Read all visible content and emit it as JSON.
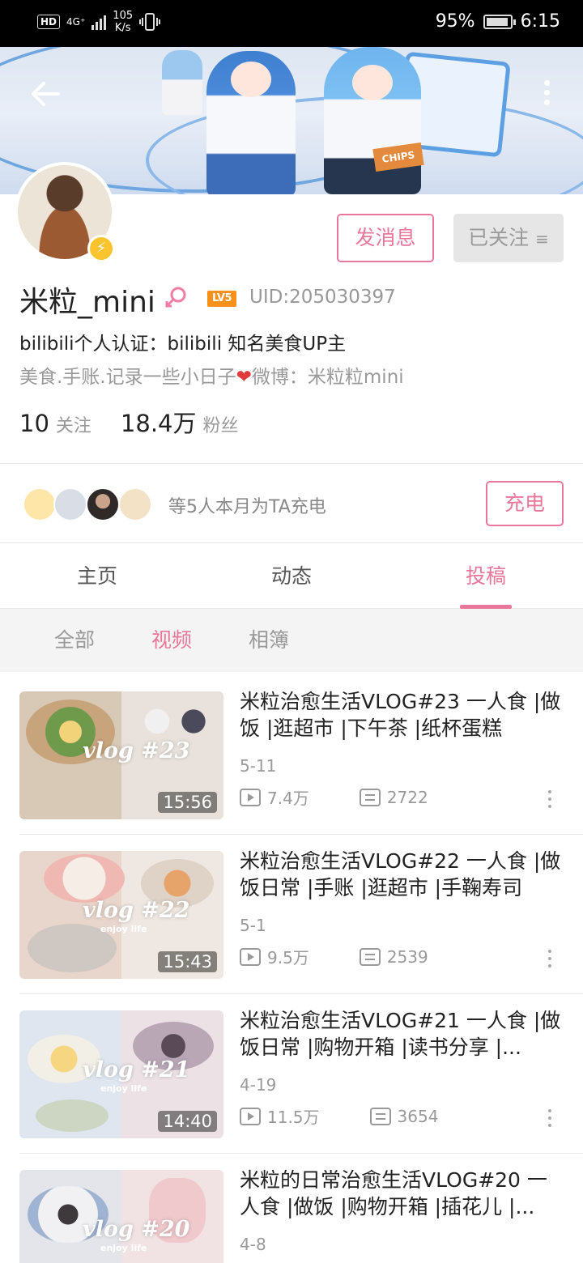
{
  "status_bar": {
    "hd": "HD",
    "network": "4G⁺",
    "speed_value": "105",
    "speed_unit": "K/s",
    "battery": "95%",
    "time": "6:15"
  },
  "banner": {
    "chips_text": "CHIPS"
  },
  "profile": {
    "name": "米粒_mini",
    "level": "LV5",
    "uid": "UID:205030397",
    "official": "bilibili个人认证：bilibili 知名美食UP主",
    "sign_part1": "美食.手账.记录一些小日子",
    "sign_heart": "❤",
    "sign_part2": "微博：米粒粒mini",
    "following_count": "10",
    "following_label": "关注",
    "fans_count": "18.4万",
    "fans_label": "粉丝"
  },
  "actions": {
    "message": "发消息",
    "followed": "已关注",
    "followed_icon": "≡"
  },
  "charge": {
    "text": "等5人本月为TA充电",
    "button": "充电"
  },
  "tabs": [
    {
      "label": "主页",
      "active": false
    },
    {
      "label": "动态",
      "active": false
    },
    {
      "label": "投稿",
      "active": true
    }
  ],
  "subtabs": [
    {
      "label": "全部",
      "active": false
    },
    {
      "label": "视频",
      "active": true
    },
    {
      "label": "相簿",
      "active": false
    }
  ],
  "videos": [
    {
      "title": "米粒治愈生活VLOG#23  一人食 |做饭 |逛超市 |下午茶 |纸杯蛋糕",
      "date": "5-11",
      "views": "7.4万",
      "danmaku": "2722",
      "duration": "15:56",
      "watermark": "vlog #23",
      "watermark_sub": ""
    },
    {
      "title": "米粒治愈生活VLOG#22  一人食 |做饭日常 |手账 |逛超市 |手鞠寿司",
      "date": "5-1",
      "views": "9.5万",
      "danmaku": "2539",
      "duration": "15:43",
      "watermark": "vlog #22",
      "watermark_sub": "enjoy life"
    },
    {
      "title": "米粒治愈生活VLOG#21  一人食 |做饭日常 |购物开箱 |读书分享 |...",
      "date": "4-19",
      "views": "11.5万",
      "danmaku": "3654",
      "duration": "14:40",
      "watermark": "vlog #21",
      "watermark_sub": "enjoy life"
    },
    {
      "title": "米粒的日常治愈生活VLOG#20 一人食 |做饭 |购物开箱 |插花儿 |...",
      "date": "4-8",
      "views": "",
      "danmaku": "",
      "duration": "",
      "watermark": "vlog #20",
      "watermark_sub": "enjoy life"
    }
  ],
  "colors": {
    "accent": "#e9779b",
    "level_badge": "#f8901c",
    "verified_badge": "#fbc42e"
  }
}
